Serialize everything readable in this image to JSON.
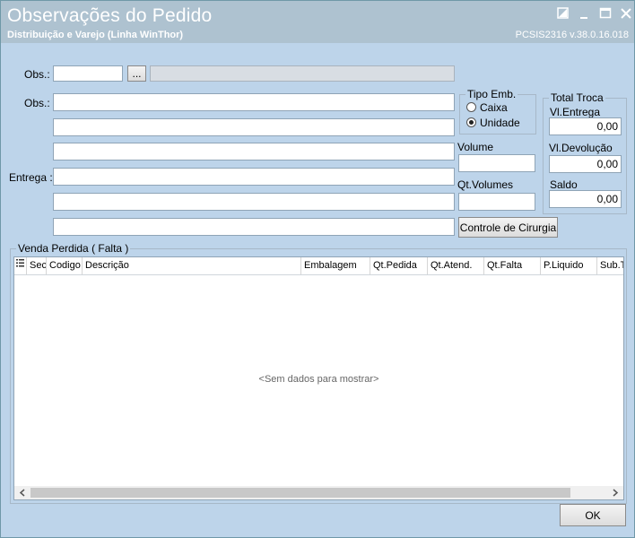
{
  "window": {
    "title": "Observações do Pedido",
    "subtitle": "Distribuição e Varejo (Linha WinThor)",
    "version": "PCSIS2316  v.38.0.16.018"
  },
  "form": {
    "obs_label_1": "Obs.:",
    "obs_label_2": "Obs.:",
    "entrega_label": "Entrega :",
    "ellipsis": "...",
    "obs_code": "",
    "obs_desc": "",
    "obs_lines": [
      "",
      "",
      "",
      "",
      "",
      ""
    ]
  },
  "tipo_emb": {
    "legend": "Tipo Emb.",
    "options": [
      "Caixa",
      "Unidade"
    ],
    "selected": "Unidade"
  },
  "volume": {
    "label": "Volume",
    "value": ""
  },
  "qt_volumes": {
    "label": "Qt.Volumes",
    "value": ""
  },
  "total_troca": {
    "legend": "Total Troca",
    "vl_entrega_label": "Vl.Entrega",
    "vl_entrega": "0,00",
    "vl_devolucao_label": "Vl.Devolução",
    "vl_devolucao": "0,00",
    "saldo_label": "Saldo",
    "saldo": "0,00"
  },
  "controle_button": "Controle de Cirurgia",
  "venda_perdida": {
    "legend": "Venda Perdida ( Falta )",
    "columns": [
      "Sec",
      "Codigo",
      "Descrição",
      "Embalagem",
      "Qt.Pedida",
      "Qt.Atend.",
      "Qt.Falta",
      "P.Liquido",
      "Sub.T"
    ],
    "empty_text": "<Sem dados para mostrar>"
  },
  "ok_button": "OK"
}
